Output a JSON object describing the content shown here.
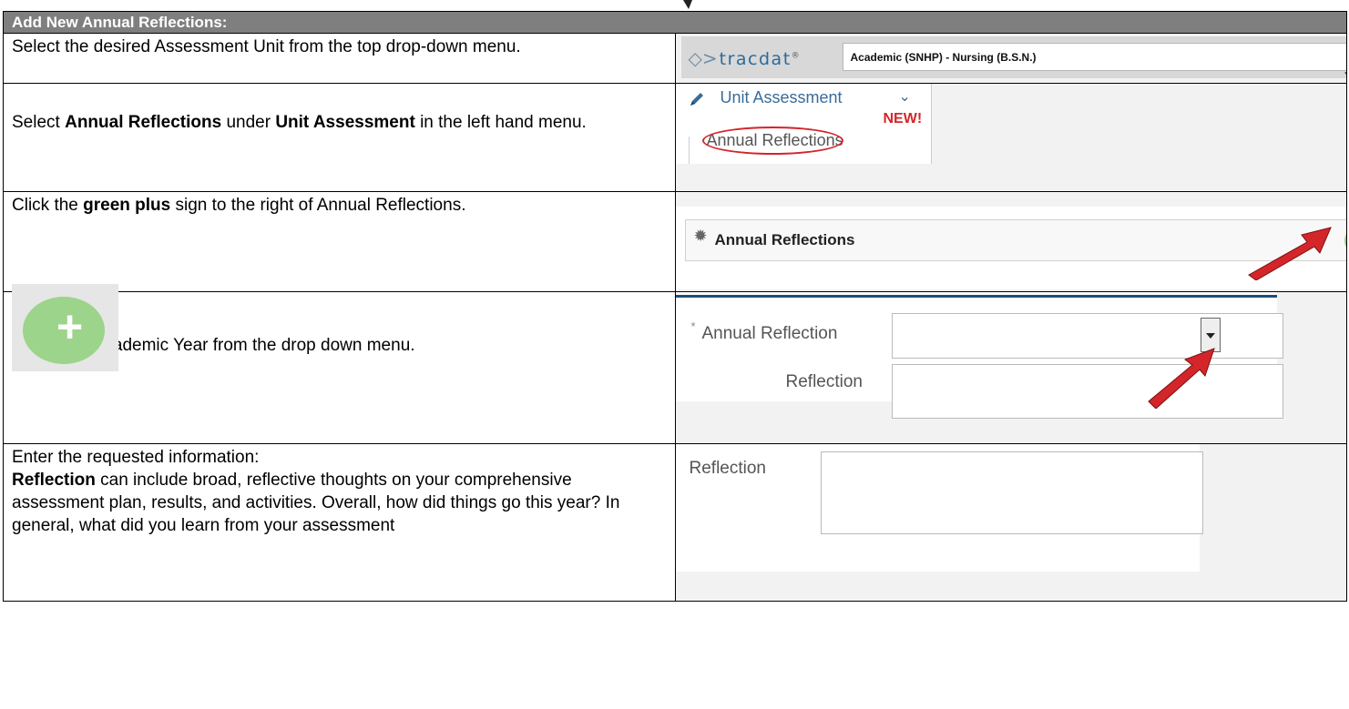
{
  "header": {
    "title": "Add New Annual Reflections:"
  },
  "rows": [
    {
      "instruction": "Select the desired Assessment Unit from the top drop-down menu."
    },
    {
      "instruction_parts": [
        "Select ",
        "Annual Reflections",
        " under ",
        "Unit Assessment",
        " in the left hand menu."
      ]
    },
    {
      "instruction_parts": [
        "Click the ",
        "green plus",
        " sign to the right of Annual Reflections."
      ]
    },
    {
      "instruction": "Select the Academic Year from the drop down menu."
    },
    {
      "instruction_line1": "Enter the requested information:",
      "instruction_parts": [
        "Reflection",
        " can include broad, reflective thoughts on your comprehensive assessment plan, results, and activities. Overall, how did things go this year? In general, what did you learn from your assessment"
      ]
    }
  ],
  "tracdat": {
    "logo_text": "tracdat",
    "selected_unit": "Academic (SNHP) - Nursing (B.S.N.)"
  },
  "menu": {
    "section_label": "Unit Assessment",
    "new_badge": "NEW!",
    "item_label": "Annual Reflections"
  },
  "annual_reflections_panel": {
    "title": "Annual Reflections"
  },
  "form": {
    "annual_reflection_label": "Annual Reflection",
    "reflection_label": "Reflection",
    "required_marker": "*"
  },
  "reflection_field": {
    "label": "Reflection"
  },
  "colors": {
    "header_bg": "#7f7f7f",
    "panel_bg": "#f2f2f2",
    "arrow_red": "#d4262a",
    "plus_green": "#9bd48a",
    "link_blue": "#3a6c98"
  }
}
